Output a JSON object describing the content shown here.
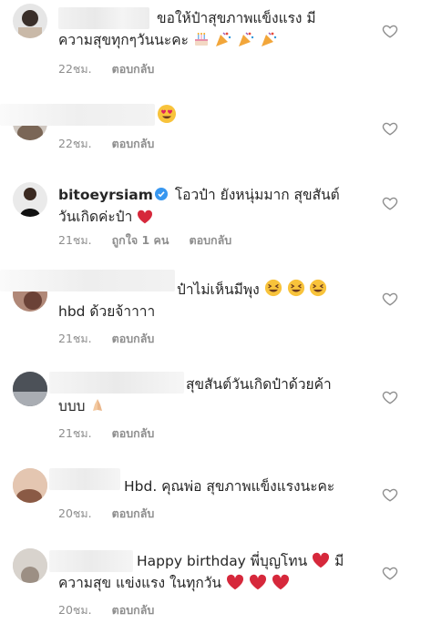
{
  "comments": [
    {
      "text_line1": "ขอให้ป๋าสุขภาพแข็งแรง มี",
      "text_line2": "ความสุขทุกๆวันนะคะ",
      "time": "22ชม.",
      "reply": "ตอบกลับ",
      "emojis": [
        "birthday-cake",
        "party-popper",
        "party-popper",
        "party-popper"
      ]
    },
    {
      "time": "22ชม.",
      "reply": "ตอบกลับ",
      "emojis": [
        "heart-eyes"
      ]
    },
    {
      "username": "bitoeyrsiam",
      "text_line1": "โอวป๋า ยังหนุ่มมาก สุขสันต์",
      "text_line2": "วันเกิดค่ะป๋า",
      "time": "21ชม.",
      "likes": "ถูกใจ 1 คน",
      "reply": "ตอบกลับ",
      "emojis": [
        "red-heart"
      ]
    },
    {
      "text_line1": "ป๋าไม่เห็นมีพุง",
      "text_line2": "hbd ด้วยจ้าาาา",
      "time": "21ชม.",
      "reply": "ตอบกลับ",
      "emojis": [
        "laughing",
        "laughing",
        "laughing"
      ]
    },
    {
      "text_line1": "สุขสันต์วันเกิดป๋าด้วยค้า",
      "text_line2": "บบบ",
      "time": "21ชม.",
      "reply": "ตอบกลับ",
      "emojis": [
        "folded-hands"
      ]
    },
    {
      "text_line1": "Hbd. คุณพ่อ สุขภาพแข็งแรงนะคะ",
      "time": "20ชม.",
      "reply": "ตอบกลับ"
    },
    {
      "text_line1": "Happy birthday พี่บุญโทน",
      "text_line1b": "มี",
      "text_line2": "ความสุข แข่งแรง ในทุกวัน",
      "time": "20ชม.",
      "reply": "ตอบกลับ",
      "emojis": [
        "red-heart",
        "red-heart",
        "red-heart",
        "red-heart"
      ]
    }
  ],
  "colors": {
    "text": "#262626",
    "meta": "#8e8e8e",
    "verified": "#3897f0",
    "heart": "#ed4956"
  }
}
